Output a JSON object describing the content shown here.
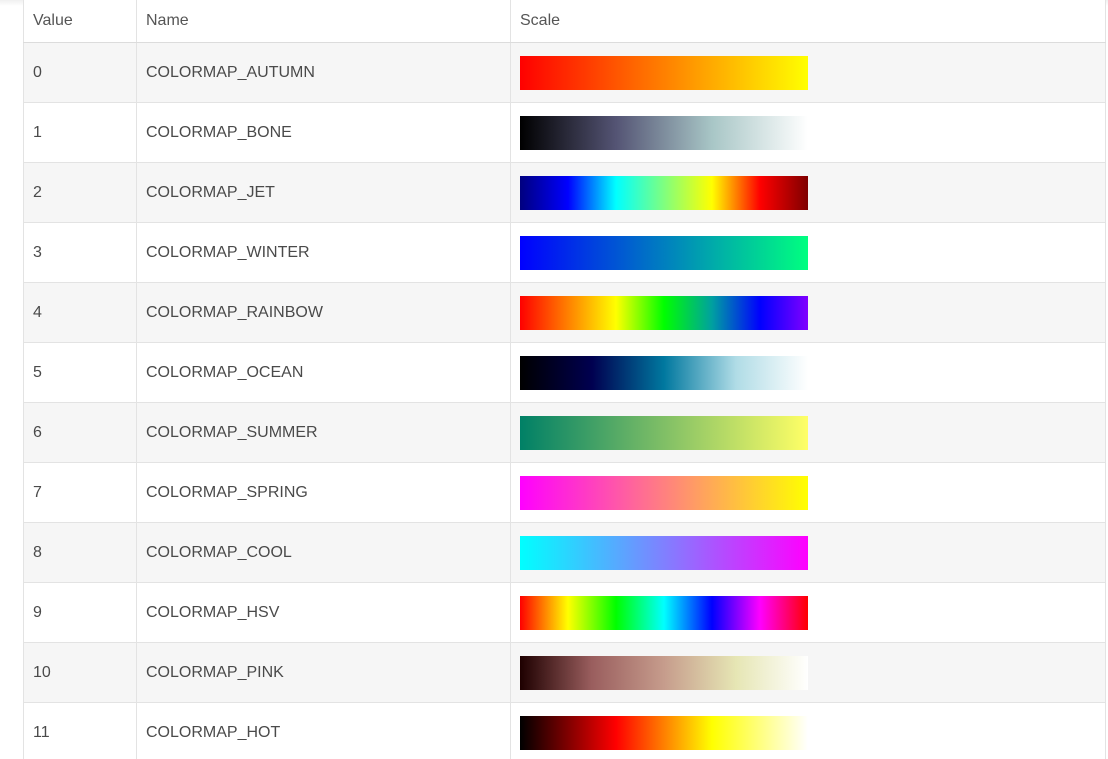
{
  "table": {
    "headers": {
      "value": "Value",
      "name": "Name",
      "scale": "Scale"
    },
    "rows": [
      {
        "value": "0",
        "name": "COLORMAP_AUTUMN",
        "gradient": "autumn"
      },
      {
        "value": "1",
        "name": "COLORMAP_BONE",
        "gradient": "bone"
      },
      {
        "value": "2",
        "name": "COLORMAP_JET",
        "gradient": "jet"
      },
      {
        "value": "3",
        "name": "COLORMAP_WINTER",
        "gradient": "winter"
      },
      {
        "value": "4",
        "name": "COLORMAP_RAINBOW",
        "gradient": "rainbow"
      },
      {
        "value": "5",
        "name": "COLORMAP_OCEAN",
        "gradient": "ocean"
      },
      {
        "value": "6",
        "name": "COLORMAP_SUMMER",
        "gradient": "summer"
      },
      {
        "value": "7",
        "name": "COLORMAP_SPRING",
        "gradient": "spring"
      },
      {
        "value": "8",
        "name": "COLORMAP_COOL",
        "gradient": "cool"
      },
      {
        "value": "9",
        "name": "COLORMAP_HSV",
        "gradient": "hsv"
      },
      {
        "value": "10",
        "name": "COLORMAP_PINK",
        "gradient": "pink"
      },
      {
        "value": "11",
        "name": "COLORMAP_HOT",
        "gradient": "hot"
      }
    ]
  },
  "colors": {
    "text": "#4a4a4a",
    "row_alt_bg": "#f6f6f6",
    "border": "#e3e3e3"
  }
}
